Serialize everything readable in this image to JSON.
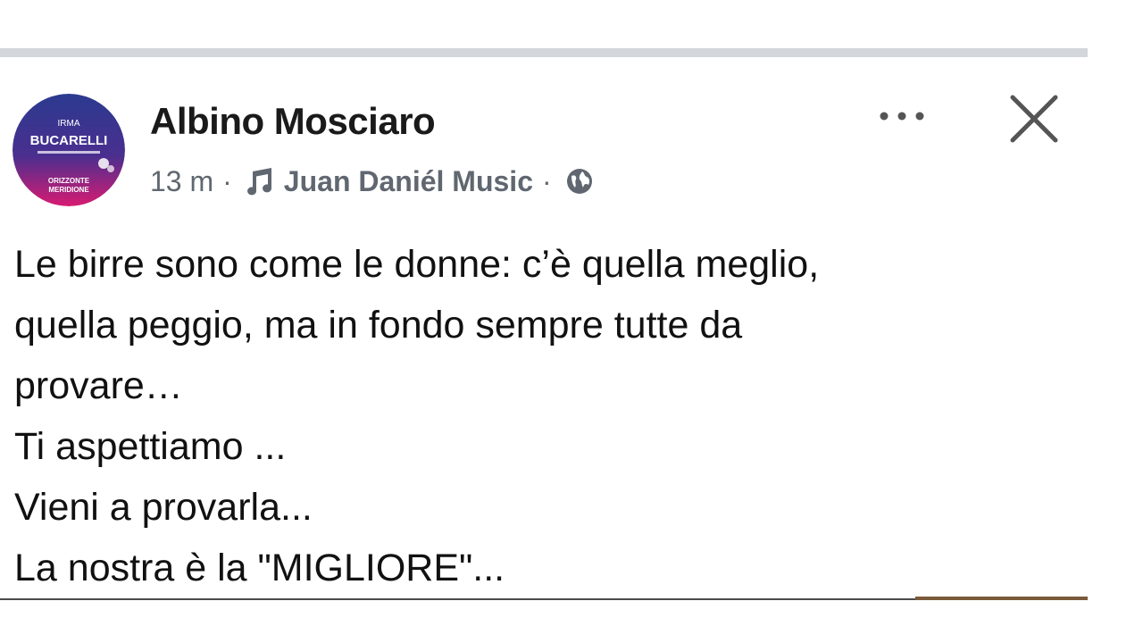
{
  "post": {
    "avatar": {
      "line1": "IRMA",
      "line2": "BUCARELLI",
      "line3": "ORIZZONTE",
      "line4": "MERIDIONE"
    },
    "author": "Albino Mosciaro",
    "time": "13 m",
    "separator": "·",
    "music": "Juan Daniél Music",
    "audience_icon": "globe-icon",
    "more_icon": "more-options-icon",
    "close_icon": "close-icon",
    "text_lines": [
      "Le birre sono come le donne: c’è quella meglio,",
      "quella peggio, ma in fondo sempre tutte da",
      "provare…",
      "Ti aspettiamo ...",
      "Vieni a provarla...",
      "La nostra è la \"MIGLIORE\"..."
    ]
  },
  "colors": {
    "avatar_top": "#2b3a8f",
    "avatar_bottom": "#d81b72",
    "meta_text": "#606770",
    "icon_gray": "#606770"
  }
}
